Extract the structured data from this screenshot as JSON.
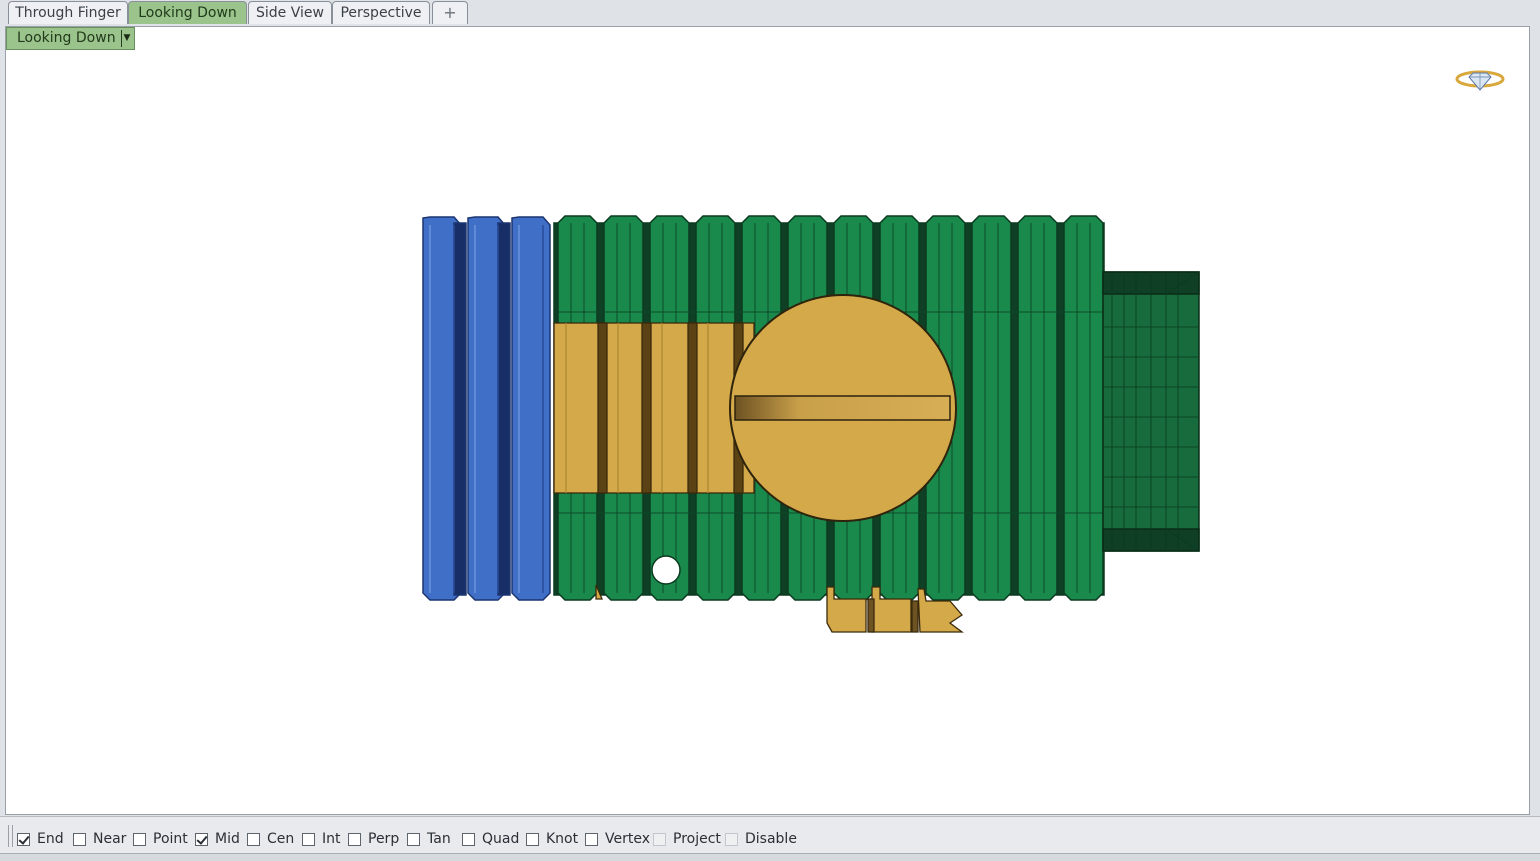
{
  "tabs": [
    {
      "label": "Through Finger",
      "active": false
    },
    {
      "label": "Looking Down",
      "active": true
    },
    {
      "label": "Side View",
      "active": false
    },
    {
      "label": "Perspective",
      "active": false
    }
  ],
  "add_tab_icon": "plus-icon",
  "viewport": {
    "label": "Looking Down",
    "menu_icon": "chevron-down-icon",
    "corner_icon": "ring-diamond-icon"
  },
  "colors": {
    "active_tab": "#9bc48d",
    "blue_part": "#3f6fc6",
    "green_part": "#1a8a4c",
    "gold_part": "#d4a94a"
  },
  "osnaps": [
    {
      "label": "End",
      "checked": true,
      "enabled": true
    },
    {
      "label": "Near",
      "checked": false,
      "enabled": true
    },
    {
      "label": "Point",
      "checked": false,
      "enabled": true
    },
    {
      "label": "Mid",
      "checked": true,
      "enabled": true
    },
    {
      "label": "Cen",
      "checked": false,
      "enabled": true
    },
    {
      "label": "Int",
      "checked": false,
      "enabled": true
    },
    {
      "label": "Perp",
      "checked": false,
      "enabled": true
    },
    {
      "label": "Tan",
      "checked": false,
      "enabled": true
    },
    {
      "label": "Quad",
      "checked": false,
      "enabled": true
    },
    {
      "label": "Knot",
      "checked": false,
      "enabled": true
    },
    {
      "label": "Vertex",
      "checked": false,
      "enabled": true
    },
    {
      "label": "Project",
      "checked": false,
      "enabled": false
    },
    {
      "label": "Disable",
      "checked": false,
      "enabled": false
    }
  ]
}
